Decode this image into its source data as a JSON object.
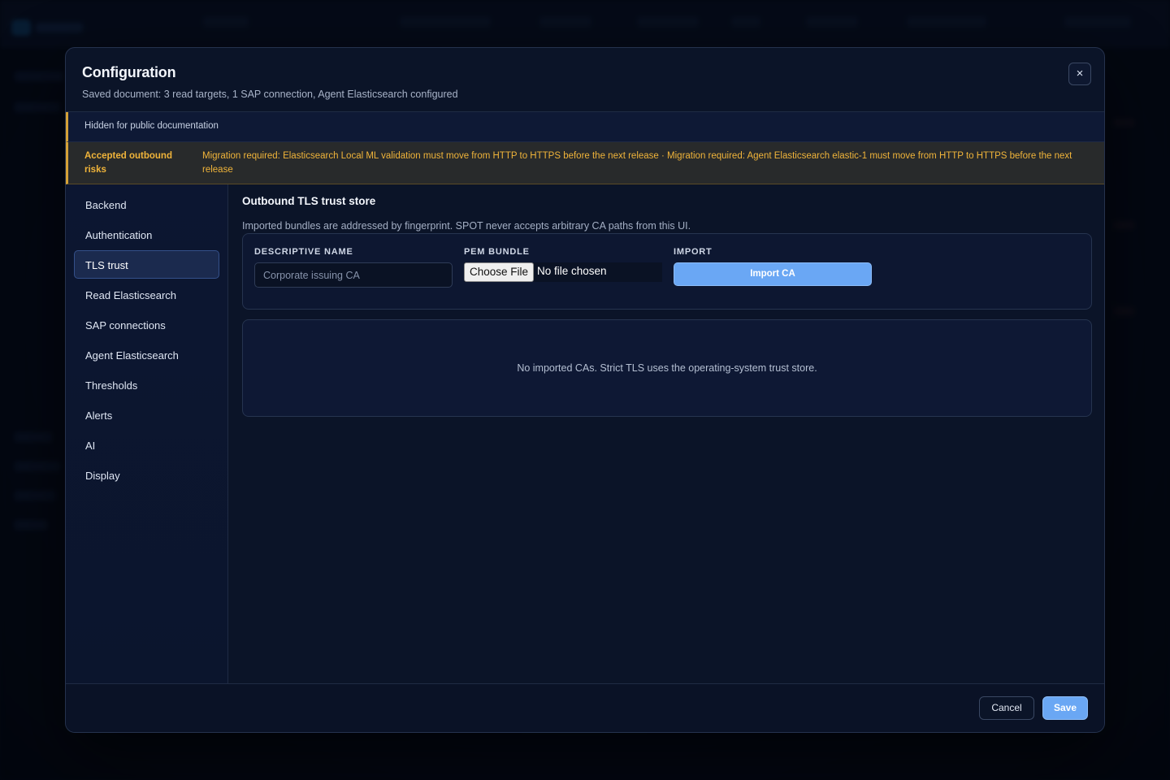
{
  "modal": {
    "title": "Configuration",
    "subtitle": "Saved document: 3 read targets, 1 SAP connection, Agent Elasticsearch configured",
    "close_label": "×"
  },
  "notice": {
    "text": "Hidden for public documentation"
  },
  "risks": {
    "label": "Accepted outbound risks",
    "text": "Migration required: Elasticsearch Local ML validation must move from HTTP to HTTPS before the next release · Migration required: Agent Elasticsearch elastic-1 must move from HTTP to HTTPS before the next release"
  },
  "sidebar": {
    "items": [
      {
        "label": "Backend",
        "active": false
      },
      {
        "label": "Authentication",
        "active": false
      },
      {
        "label": "TLS trust",
        "active": true
      },
      {
        "label": "Read Elasticsearch",
        "active": false
      },
      {
        "label": "SAP connections",
        "active": false
      },
      {
        "label": "Agent Elasticsearch",
        "active": false
      },
      {
        "label": "Thresholds",
        "active": false
      },
      {
        "label": "Alerts",
        "active": false
      },
      {
        "label": "AI",
        "active": false
      },
      {
        "label": "Display",
        "active": false
      }
    ]
  },
  "tls": {
    "title": "Outbound TLS trust store",
    "description": "Imported bundles are addressed by fingerprint. SPOT never accepts arbitrary CA paths from this UI.",
    "form": {
      "name_label": "DESCRIPTIVE NAME",
      "name_placeholder": "Corporate issuing CA",
      "name_value": "",
      "pem_label": "PEM BUNDLE",
      "file_button": "Choose File",
      "file_status": "No file chosen",
      "import_label": "IMPORT",
      "import_button": "Import CA"
    },
    "empty_message": "No imported CAs. Strict TLS uses the operating-system trust store."
  },
  "footer": {
    "cancel": "Cancel",
    "save": "Save"
  },
  "colors": {
    "accent": "#6aa7f4",
    "warning": "#f0b43a",
    "surface": "#0b1428"
  }
}
